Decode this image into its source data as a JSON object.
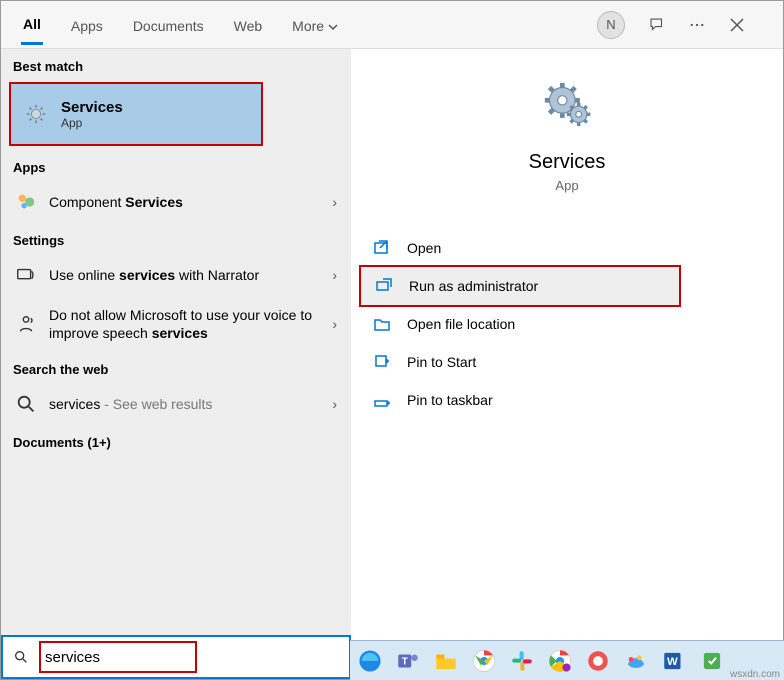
{
  "tabs": {
    "all": "All",
    "apps": "Apps",
    "documents": "Documents",
    "web": "Web",
    "more": "More"
  },
  "avatar_initial": "N",
  "sections": {
    "best_match": "Best match",
    "apps": "Apps",
    "settings": "Settings",
    "search_web": "Search the web",
    "documents": "Documents (1+)"
  },
  "best_match": {
    "title": "Services",
    "sub": "App"
  },
  "apps_result_prefix": "Component ",
  "apps_result_bold": "Services",
  "settings": {
    "item1_prefix": "Use online ",
    "item1_bold": "services",
    "item1_suffix": " with Narrator",
    "item2_prefix": "Do not allow Microsoft to use your voice to improve speech ",
    "item2_bold": "services"
  },
  "web_result_prefix": "services",
  "web_result_suffix": " - See web results",
  "details": {
    "title": "Services",
    "sub": "App"
  },
  "actions": {
    "open": "Open",
    "run_admin": "Run as administrator",
    "open_loc": "Open file location",
    "pin_start": "Pin to Start",
    "pin_taskbar": "Pin to taskbar"
  },
  "search_value": "services",
  "watermark": "wsxdn.com"
}
